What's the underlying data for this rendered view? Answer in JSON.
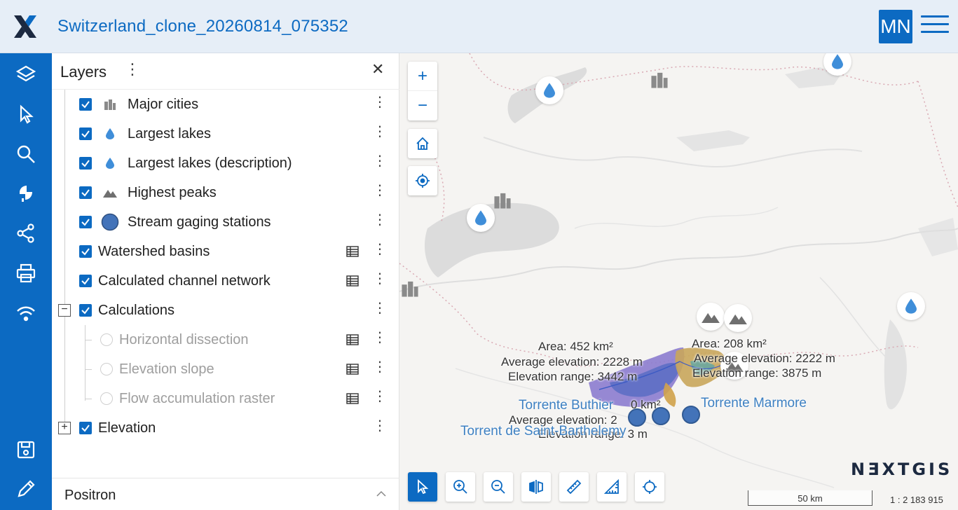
{
  "header": {
    "title": "Switzerland_clone_20260814_075352",
    "avatar_initials": "MN",
    "accent": "#0c6ac2"
  },
  "rail": {
    "icons": [
      "layers-icon",
      "select-icon",
      "search-icon",
      "annotations-icon",
      "share-icon",
      "print-icon",
      "wifi-icon",
      "save-icon",
      "edit-icon"
    ]
  },
  "layers_panel": {
    "title": "Layers",
    "items": [
      {
        "label": "Major cities",
        "icon": "building-icon",
        "checked": true
      },
      {
        "label": "Largest lakes",
        "icon": "drop-icon",
        "checked": true
      },
      {
        "label": "Largest lakes (description)",
        "icon": "drop-icon",
        "checked": true
      },
      {
        "label": "Highest peaks",
        "icon": "mountain-icon",
        "checked": true
      },
      {
        "label": "Stream gaging stations",
        "icon": "circle-icon",
        "checked": true
      },
      {
        "label": "Watershed basins",
        "checked": true
      },
      {
        "label": "Calculated channel network",
        "checked": true
      },
      {
        "label": "Calculations",
        "checked": true,
        "expanded": true
      },
      {
        "label": "Horizontal dissection",
        "radio": true
      },
      {
        "label": "Elevation slope",
        "radio": true
      },
      {
        "label": "Flow accumulation raster",
        "radio": true
      },
      {
        "label": "Elevation",
        "checked": true,
        "expanded": false
      }
    ],
    "basemap_label": "Positron"
  },
  "map": {
    "brand": "NƎXTGIS",
    "scale_label": "50 km",
    "scale_ratio": "1 : 2 183 915",
    "labels": {
      "area_west": "Area: 452 km²",
      "avg_west": "Average elevation: 2228 m",
      "range_west": "Elevation range: 3442 m",
      "area_east": "Area: 208 km²",
      "avg_east": "Average elevation: 2222 m",
      "range_east": "Elevation range: 3875 m",
      "area_south": "0 km²",
      "avg_south": "Average elevation: 2",
      "range_south": "Elevation range: 3 m",
      "river_buthier": "Torrente Buthier",
      "river_marmore": "Torrente Marmore",
      "river_barthelemy": "Torrent de Saint-Barthelemy"
    }
  }
}
